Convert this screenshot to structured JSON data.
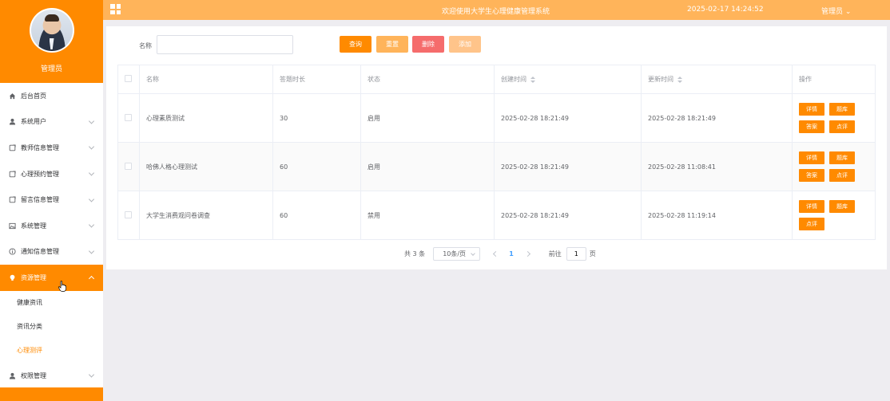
{
  "sidebar": {
    "admin_name": "管理员",
    "items": [
      {
        "label": "后台首页",
        "icon": "home-icon",
        "has_arrow": false
      },
      {
        "label": "系统用户",
        "icon": "user-icon",
        "has_arrow": true
      },
      {
        "label": "教师信息管理",
        "icon": "doc-icon",
        "has_arrow": true
      },
      {
        "label": "心理预约管理",
        "icon": "doc-icon",
        "has_arrow": true
      },
      {
        "label": "留言信息管理",
        "icon": "doc-icon",
        "has_arrow": true
      },
      {
        "label": "系统管理",
        "icon": "image-icon",
        "has_arrow": true
      },
      {
        "label": "通知信息管理",
        "icon": "info-icon",
        "has_arrow": true
      },
      {
        "label": "资源管理",
        "icon": "bulb-icon",
        "has_arrow": true,
        "active": true
      }
    ],
    "subitems": [
      {
        "label": "健康资讯"
      },
      {
        "label": "资讯分类"
      },
      {
        "label": "心理测评",
        "current": true
      }
    ],
    "bottom_item": {
      "label": "权限管理",
      "icon": "user-icon"
    }
  },
  "topbar": {
    "title": "欢迎使用大学生心理健康管理系统",
    "datetime": "2025-02-17 14:24:52",
    "user": "管理员",
    "user_caret": "⌄"
  },
  "search": {
    "label": "名称",
    "value": "",
    "placeholder": ""
  },
  "buttons": {
    "query": "查询",
    "reset": "重置",
    "delete": "删除",
    "add": "添加"
  },
  "table": {
    "headers": {
      "name": "名称",
      "duration": "答题时长",
      "status": "状态",
      "created": "创建时间",
      "updated": "更新时间",
      "ops": "操作"
    },
    "rows": [
      {
        "name": "心理素质测试",
        "duration": "30",
        "status": "启用",
        "created": "2025-02-28 18:21:49",
        "updated": "2025-02-28 18:21:49",
        "ops": [
          "详情",
          "题库",
          "答案",
          "点评"
        ]
      },
      {
        "name": "哈佛人格心理测试",
        "duration": "60",
        "status": "启用",
        "created": "2025-02-28 18:21:49",
        "updated": "2025-02-28 11:08:41",
        "ops": [
          "详情",
          "题库",
          "答案",
          "点评"
        ]
      },
      {
        "name": "大学生消费观问卷调查",
        "duration": "60",
        "status": "禁用",
        "created": "2025-02-28 18:21:49",
        "updated": "2025-02-28 11:19:14",
        "ops": [
          "详情",
          "题库",
          "点评"
        ]
      }
    ]
  },
  "pagination": {
    "total": "共 3 条",
    "page_size": "10条/页",
    "current_page": "1",
    "goto_label": "前往",
    "goto_value": "1",
    "page_unit": "页"
  },
  "colors": {
    "brand": "#ff8a00",
    "topbar": "#ffb45a",
    "danger": "#f56c6c",
    "link": "#409eff"
  }
}
